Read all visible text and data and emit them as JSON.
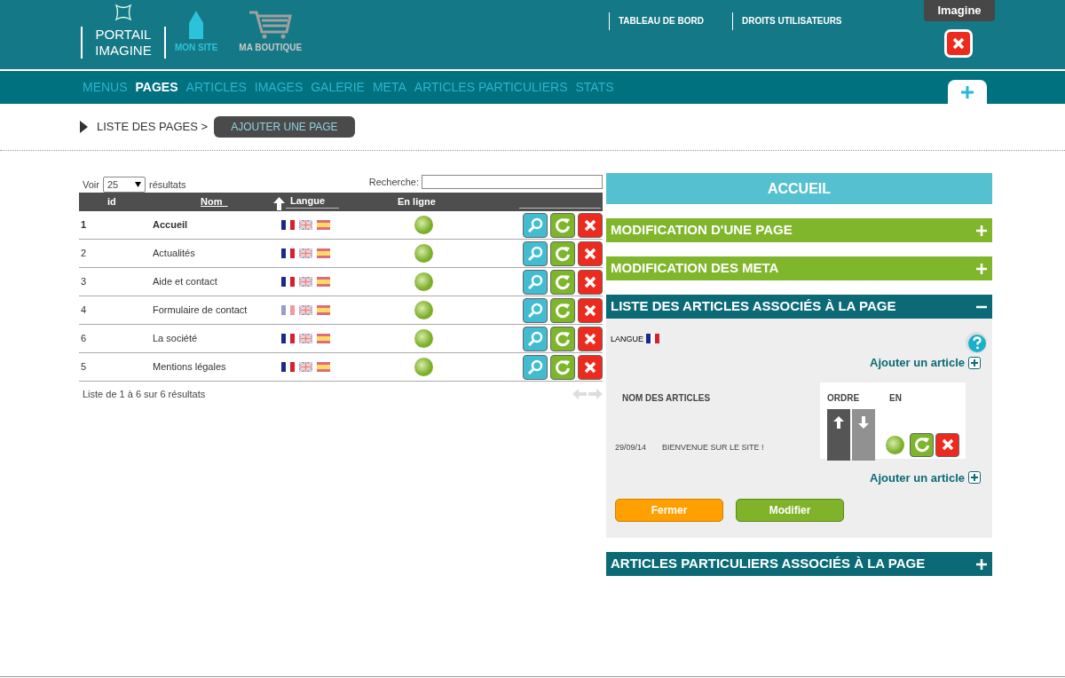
{
  "brand": {
    "line1": "PORTAIL",
    "line2": "IMAGINE"
  },
  "top_links": [
    {
      "label": "MON SITE",
      "selected": true,
      "kind": "pencil"
    },
    {
      "label": "MA BOUTIQUE",
      "selected": false,
      "kind": "cart"
    }
  ],
  "admin_links": [
    "TABLEAU DE BORD",
    "DROITS UTILISATEURS"
  ],
  "user": {
    "name": "Imagine"
  },
  "nav": [
    {
      "label": "MENUS",
      "selected": false
    },
    {
      "label": "PAGES",
      "selected": true
    },
    {
      "label": "ARTICLES",
      "selected": false
    },
    {
      "label": "IMAGES",
      "selected": false
    },
    {
      "label": "GALERIE",
      "selected": false
    },
    {
      "label": "META",
      "selected": false
    },
    {
      "label": "ARTICLES PARTICULIERS",
      "selected": false
    },
    {
      "label": "STATS",
      "selected": false
    }
  ],
  "breadcrumb": {
    "current": "LISTE DES PAGES >",
    "button": "AJOUTER UNE PAGE"
  },
  "table": {
    "show_label": "Voir",
    "page_size": "25",
    "results_label": "résultats",
    "search_label": "Recherche:",
    "columns": [
      "id",
      "Nom",
      "Langue",
      "En ligne"
    ],
    "rows": [
      {
        "id": "1",
        "name": "Accueil",
        "selected": true,
        "fr_dimmed": false
      },
      {
        "id": "2",
        "name": "Actualités",
        "selected": false,
        "fr_dimmed": false
      },
      {
        "id": "3",
        "name": "Aide et contact",
        "selected": false,
        "fr_dimmed": false
      },
      {
        "id": "4",
        "name": "Formulaire de contact",
        "selected": false,
        "fr_dimmed": true
      },
      {
        "id": "6",
        "name": "La société",
        "selected": false,
        "fr_dimmed": false
      },
      {
        "id": "5",
        "name": "Mentions légales",
        "selected": false,
        "fr_dimmed": false
      }
    ],
    "footer": "Liste de 1 à 6 sur 6 résultats"
  },
  "panel": {
    "title": "ACCUEIL",
    "sections": [
      {
        "title": "MODIFICATION D'UNE PAGE",
        "kind": "green",
        "expanded": false
      },
      {
        "title": "MODIFICATION DES META",
        "kind": "green",
        "expanded": false
      },
      {
        "title": "LISTE DES ARTICLES ASSOCIÉS À LA PAGE",
        "kind": "teal",
        "expanded": true
      }
    ],
    "language_label": "LANGUE",
    "add_article_links": [
      "Ajouter un article",
      "Ajouter un article"
    ],
    "articles_columns": [
      "NOM DES ARTICLES",
      "ORDRE",
      "EN"
    ],
    "articles": [
      {
        "date": "29/09/14",
        "title": "BIENVENUE SUR LE SITE !"
      }
    ],
    "close_button": "Fermer",
    "save_button": "Modifier",
    "bottom_section": {
      "title": "ARTICLES PARTICULIERS ASSOCIÉS À LA PAGE",
      "expanded": false
    }
  }
}
